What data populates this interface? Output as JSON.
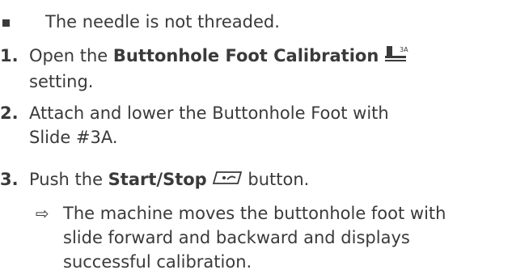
{
  "top_fragment": "...",
  "prerequisite": {
    "text": "The needle is not threaded."
  },
  "steps": [
    {
      "number": "1.",
      "prefix": "Open the ",
      "bold": "Buttonhole Foot Calibration",
      "icon": "buttonhole-foot-icon",
      "icon_label": "3A",
      "suffix_line2": "setting."
    },
    {
      "number": "2.",
      "line1": "Attach and lower the Buttonhole Foot with",
      "line2": "Slide #3A."
    },
    {
      "number": "3.",
      "prefix": "Push the ",
      "bold": "Start/Stop",
      "icon": "start-stop-icon",
      "suffix": " button."
    }
  ],
  "result": {
    "arrow": "⇨",
    "lines": [
      "The machine moves the buttonhole foot with",
      "slide forward and backward and displays",
      "successful calibration."
    ]
  }
}
